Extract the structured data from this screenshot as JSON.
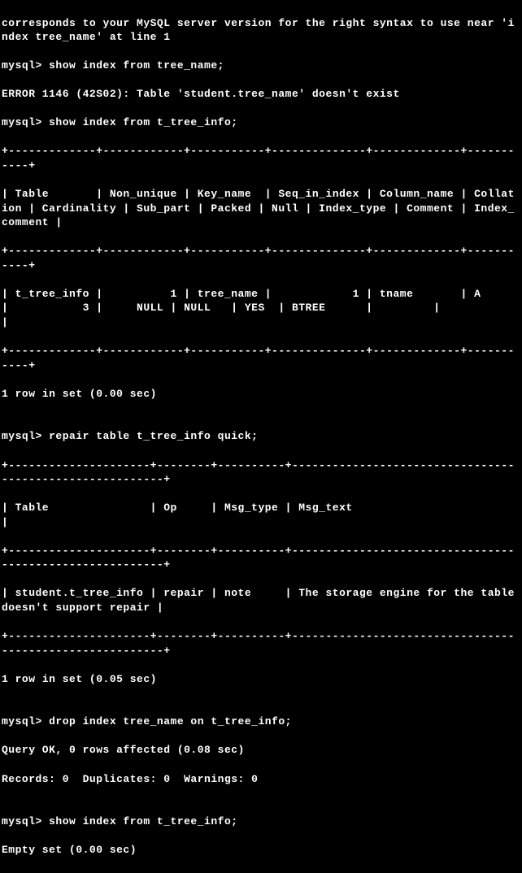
{
  "lines": [
    "corresponds to your MySQL server version for the right syntax to use near 'index tree_name' at line 1",
    "mysql> show index from tree_name;",
    "ERROR 1146 (42S02): Table 'student.tree_name' doesn't exist",
    "mysql> show index from t_tree_info;",
    "+-------------+------------+-----------+--------------+-------------+-----------+",
    "| Table       | Non_unique | Key_name  | Seq_in_index | Column_name | Collation | Cardinality | Sub_part | Packed | Null | Index_type | Comment | Index_comment |",
    "+-------------+------------+-----------+--------------+-------------+-----------+",
    "| t_tree_info |          1 | tree_name |            1 | tname       | A         |           3 |     NULL | NULL   | YES  | BTREE      |         |               |",
    "+-------------+------------+-----------+--------------+-------------+-----------+",
    "1 row in set (0.00 sec)",
    "",
    "mysql> repair table t_tree_info quick;",
    "+---------------------+--------+----------+---------------------------------------------------------+",
    "| Table               | Op     | Msg_type | Msg_text                                                |",
    "+---------------------+--------+----------+---------------------------------------------------------+",
    "| student.t_tree_info | repair | note     | The storage engine for the table doesn't support repair |",
    "+---------------------+--------+----------+---------------------------------------------------------+",
    "1 row in set (0.05 sec)",
    "",
    "mysql> drop index tree_name on t_tree_info;",
    "Query OK, 0 rows affected (0.08 sec)",
    "Records: 0  Duplicates: 0  Warnings: 0",
    "",
    "mysql> show index from t_tree_info;",
    "Empty set (0.00 sec)"
  ],
  "chart_data": {
    "type": "table",
    "tables": [
      {
        "title": "show index from t_tree_info",
        "columns": [
          "Table",
          "Non_unique",
          "Key_name",
          "Seq_in_index",
          "Column_name",
          "Collation",
          "Cardinality",
          "Sub_part",
          "Packed",
          "Null",
          "Index_type",
          "Comment",
          "Index_comment"
        ],
        "rows": [
          [
            "t_tree_info",
            1,
            "tree_name",
            1,
            "tname",
            "A",
            3,
            null,
            null,
            "YES",
            "BTREE",
            "",
            ""
          ]
        ],
        "footer": "1 row in set (0.00 sec)"
      },
      {
        "title": "repair table t_tree_info quick",
        "columns": [
          "Table",
          "Op",
          "Msg_type",
          "Msg_text"
        ],
        "rows": [
          [
            "student.t_tree_info",
            "repair",
            "note",
            "The storage engine for the table doesn't support repair"
          ]
        ],
        "footer": "1 row in set (0.05 sec)"
      }
    ],
    "commands": [
      {
        "prompt": "mysql>",
        "cmd": "show index from tree_name;",
        "result": "ERROR 1146 (42S02): Table 'student.tree_name' doesn't exist"
      },
      {
        "prompt": "mysql>",
        "cmd": "show index from t_tree_info;",
        "result": "1 row in set (0.00 sec)"
      },
      {
        "prompt": "mysql>",
        "cmd": "repair table t_tree_info quick;",
        "result": "1 row in set (0.05 sec)"
      },
      {
        "prompt": "mysql>",
        "cmd": "drop index tree_name on t_tree_info;",
        "result": "Query OK, 0 rows affected (0.08 sec)\nRecords: 0  Duplicates: 0  Warnings: 0"
      },
      {
        "prompt": "mysql>",
        "cmd": "show index from t_tree_info;",
        "result": "Empty set (0.00 sec)"
      }
    ],
    "preceding_error": "corresponds to your MySQL server version for the right syntax to use near 'index tree_name' at line 1"
  }
}
